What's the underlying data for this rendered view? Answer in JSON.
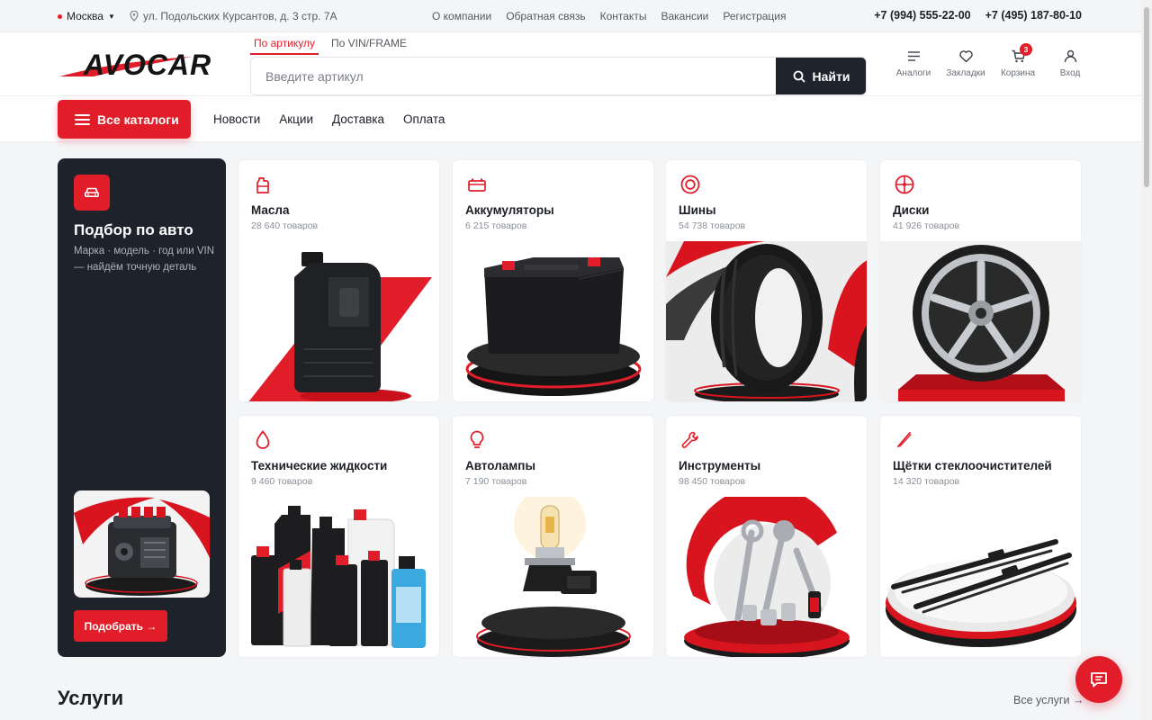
{
  "topbar": {
    "city": "Москва",
    "address": "ул. Подольских Курсантов, д. 3 стр. 7А",
    "links": [
      "О компании",
      "Обратная связь",
      "Контакты",
      "Вакансии",
      "Регистрация"
    ],
    "phones": [
      "+7 (994) 555-22-00",
      "+7 (495) 187-80-10"
    ]
  },
  "header": {
    "logo_text": "AVOCAR",
    "search_tabs": [
      "По артикулу",
      "По VIN/FRAME"
    ],
    "search_placeholder": "Введите артикул",
    "search_value": "",
    "search_button": "Найти",
    "icons": [
      {
        "label": "Аналоги",
        "icon": "list-icon"
      },
      {
        "label": "Закладки",
        "icon": "heart-icon"
      },
      {
        "label": "Корзина",
        "icon": "cart-icon",
        "badge": "3"
      },
      {
        "label": "Вход",
        "icon": "user-icon"
      }
    ]
  },
  "nav": {
    "catalog_button": "Все каталоги",
    "links": [
      "Новости",
      "Акции",
      "Доставка",
      "Оплата"
    ]
  },
  "promo": {
    "title": "Подбор по авто",
    "description": "Марка · модель · год или VIN — найдём точную деталь",
    "button": "Подобрать →"
  },
  "categories": [
    {
      "title": "Масла",
      "count": "28 640 товаров",
      "icon": "oil-canister-icon"
    },
    {
      "title": "Аккумуляторы",
      "count": "6 215 товаров",
      "icon": "battery-icon"
    },
    {
      "title": "Шины",
      "count": "54 738 товаров",
      "icon": "tire-icon"
    },
    {
      "title": "Диски",
      "count": "41 926 товаров",
      "icon": "wheel-rim-icon"
    },
    {
      "title": "Технические жидкости",
      "count": "9 460 товаров",
      "icon": "drop-icon"
    },
    {
      "title": "Автолампы",
      "count": "7 190 товаров",
      "icon": "bulb-icon"
    },
    {
      "title": "Инструменты",
      "count": "98 450 товаров",
      "icon": "wrench-icon"
    },
    {
      "title": "Щётки стеклоочистителей",
      "count": "14 320 товаров",
      "icon": "wiper-icon"
    }
  ],
  "services": {
    "title": "Услуги",
    "all_link": "Все услуги →"
  },
  "colors": {
    "accent": "#e11d2a",
    "dark": "#1e232b"
  }
}
